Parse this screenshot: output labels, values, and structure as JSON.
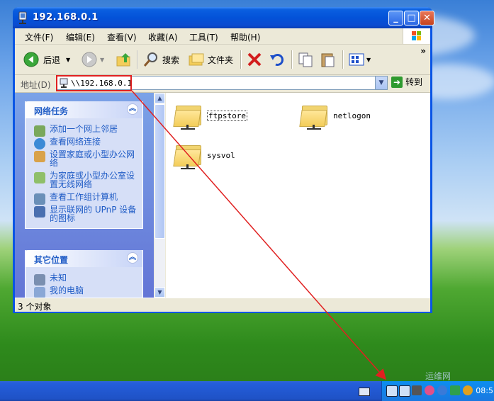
{
  "window": {
    "title": "192.168.0.1",
    "menu": [
      "文件(F)",
      "编辑(E)",
      "查看(V)",
      "收藏(A)",
      "工具(T)",
      "帮助(H)"
    ],
    "controls": {
      "minimize": "_",
      "maximize": "□",
      "close": "✕"
    }
  },
  "toolbar": {
    "back_label": "后退",
    "search_label": "搜索",
    "folders_label": "文件夹",
    "more": "»"
  },
  "address": {
    "label": "地址(D)",
    "value": "\\\\192.168.0.1",
    "go_label": "转到"
  },
  "left_panel": {
    "network_tasks": {
      "title": "网络任务",
      "items": [
        "添加一个网上邻居",
        "查看网络连接",
        "设置家庭或小型办公网络",
        "为家庭或小型办公室设置无线网络",
        "查看工作组计算机",
        "显示联网的 UPnP 设备的图标"
      ]
    },
    "other_places": {
      "title": "其它位置",
      "items": [
        "未知",
        "我的电脑"
      ]
    }
  },
  "shares": [
    "ftpstore",
    "netlogon",
    "sysvol"
  ],
  "status": {
    "text": "3 个对象"
  },
  "taskbar": {
    "clock": "08:5",
    "watermark": "运维网"
  },
  "colors": {
    "title_blue": "#0352d8",
    "task_link": "#215dc6",
    "highlight_red": "#e02020"
  }
}
